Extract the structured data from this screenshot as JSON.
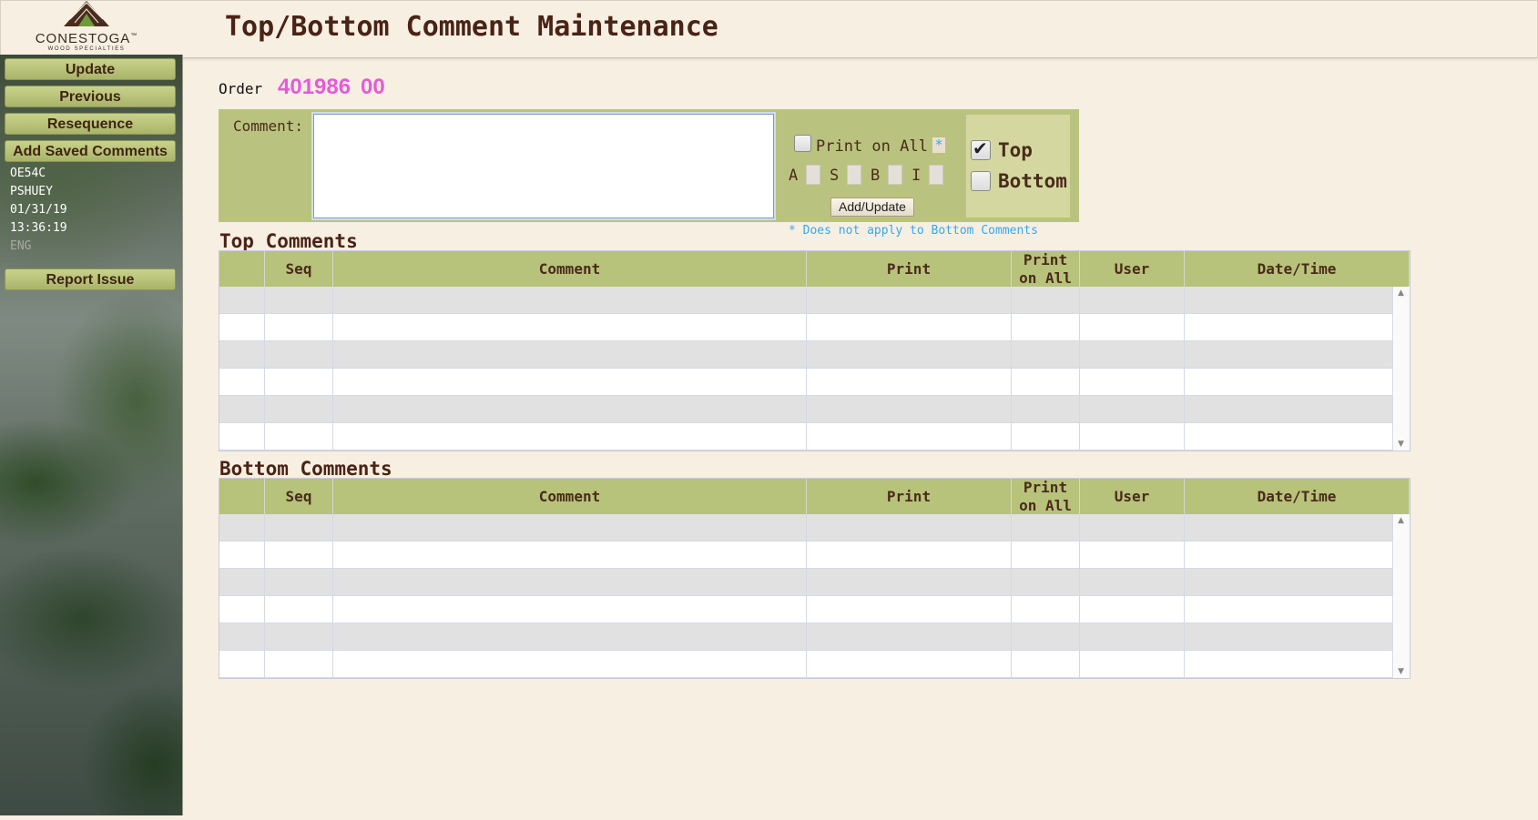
{
  "header": {
    "logo_brand": "CONESTOGA",
    "logo_trademark": "™",
    "logo_tagline": "WOOD SPECIALTIES",
    "title": "Top/Bottom Comment Maintenance"
  },
  "sidebar": {
    "buttons": [
      "Update",
      "Previous",
      "Resequence",
      "Add Saved Comments"
    ],
    "info": [
      "OE54C",
      "PSHUEY",
      "01/31/19",
      "13:36:19"
    ],
    "language": "ENG",
    "report_button": "Report Issue"
  },
  "order": {
    "label": "Order",
    "number": "401986",
    "suffix": "00"
  },
  "comment_form": {
    "label": "Comment:",
    "value": "",
    "print_on_all_label": "Print on All",
    "asterisk": "*",
    "print_options": [
      "A",
      "S",
      "B",
      "I"
    ],
    "add_button": "Add/Update",
    "top_label": "Top",
    "top_checked": true,
    "bottom_label": "Bottom",
    "bottom_checked": false,
    "note": "* Does not apply to Bottom Comments"
  },
  "top_comments": {
    "title": "Top Comments",
    "columns": [
      "",
      "Seq",
      "Comment",
      "Print",
      "Print on All",
      "User",
      "Date/Time"
    ],
    "rows": []
  },
  "bottom_comments": {
    "title": "Bottom Comments",
    "columns": [
      "",
      "Seq",
      "Comment",
      "Print",
      "Print on All",
      "User",
      "Date/Time"
    ],
    "rows": []
  },
  "colors": {
    "accent_green": "#b7c27a",
    "order_magenta": "#e65ad8",
    "note_blue": "#35a9ef",
    "title_brown": "#4a2316"
  }
}
